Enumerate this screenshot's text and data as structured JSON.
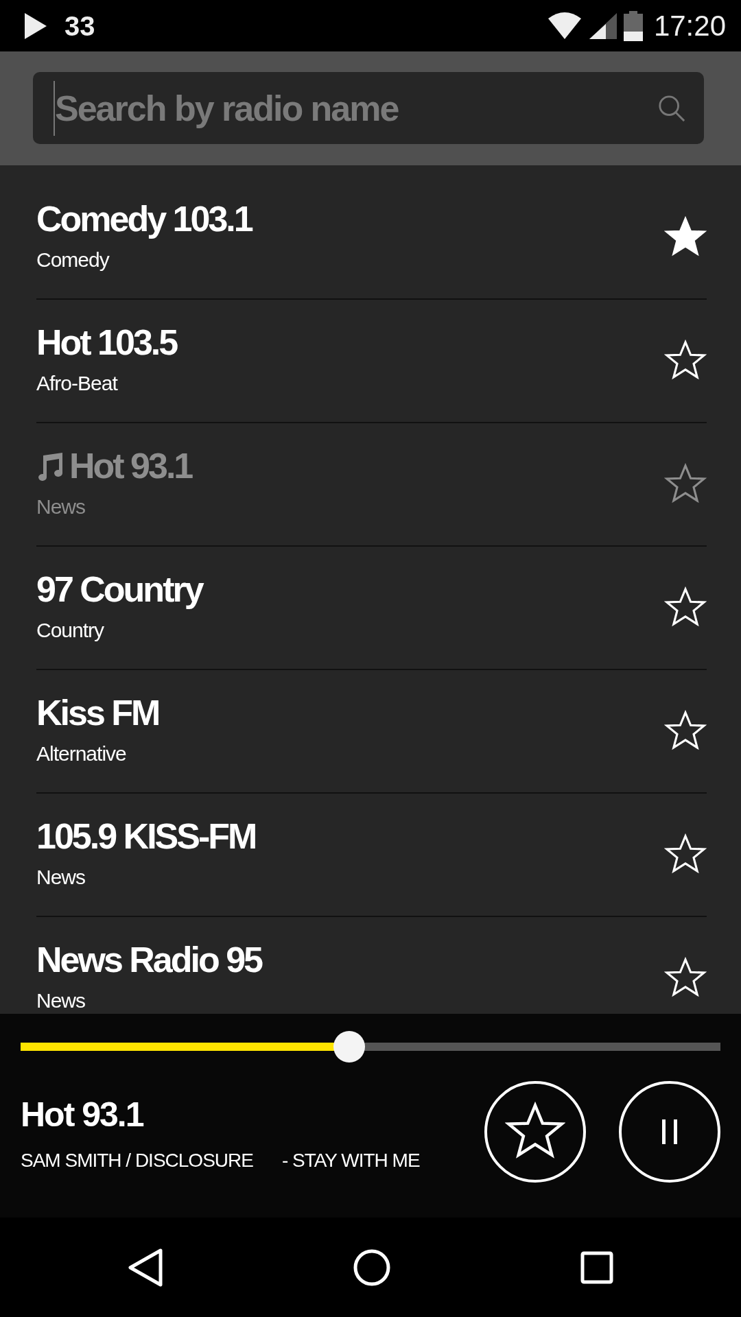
{
  "status_bar": {
    "notification_count": "33",
    "time": "17:20"
  },
  "search": {
    "placeholder": "Search by radio name"
  },
  "stations": [
    {
      "name": "Comedy 103.1",
      "genre": "Comedy",
      "favorite": true,
      "playing": false
    },
    {
      "name": "Hot 103.5",
      "genre": "Afro-Beat",
      "favorite": false,
      "playing": false
    },
    {
      "name": "Hot 93.1",
      "genre": "News",
      "favorite": false,
      "playing": true
    },
    {
      "name": "97 Country",
      "genre": "Country",
      "favorite": false,
      "playing": false
    },
    {
      "name": "Kiss FM",
      "genre": "Alternative",
      "favorite": false,
      "playing": false
    },
    {
      "name": "105.9 KISS-FM",
      "genre": "News",
      "favorite": false,
      "playing": false
    },
    {
      "name": "News Radio 95",
      "genre": "News",
      "favorite": false,
      "playing": false
    }
  ],
  "player": {
    "station": "Hot 93.1",
    "artist": "SAM SMITH / DISCLOSURE",
    "track": "- STAY WITH ME",
    "level": 0.47,
    "favorite": false,
    "playing": true
  }
}
